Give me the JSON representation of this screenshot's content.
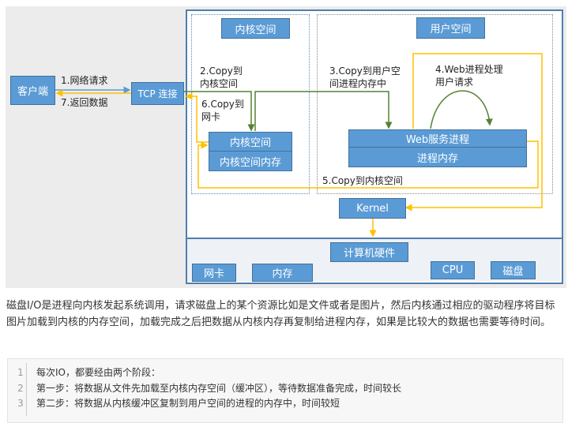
{
  "diagram": {
    "kernel_space_title": "内核空间",
    "user_space_title": "用户空间",
    "client": "客户端",
    "tcp": "TCP 连接",
    "step1": "1.网络请求",
    "step7": "7.返回数据",
    "step2": [
      "2.Copy到",
      "内核空间"
    ],
    "step6": [
      "6.Copy到",
      "网卡"
    ],
    "step3": [
      "3.Copy到用户空",
      "间进程内存中"
    ],
    "step4": [
      "4.Web进程处理",
      "用户请求"
    ],
    "step5": "5.Copy到内核空间",
    "kernel_box_top": "内核空间",
    "kernel_box_bottom": "内核空间内存",
    "web_top": "Web服务进程",
    "web_bottom": "进程内存",
    "kernel": "Kernel",
    "hardware": "计算机硬件",
    "nic": "网卡",
    "memory": "内存",
    "cpu": "CPU",
    "disk": "磁盘",
    "colors": {
      "box": "#5b9bd5",
      "green": "#548235",
      "yellow": "#ffc000",
      "blue_arrow": "#5b9bd5"
    }
  },
  "paragraph": "磁盘I/O是进程向内核发起系统调用，请求磁盘上的某个资源比如是文件或者是图片，然后内核通过相应的驱动程序将目标图片加载到内核的内存空间，加载完成之后把数据从内核内存再复制给进程内存，如果是比较大的数据也需要等待时间。",
  "code": {
    "lines": [
      {
        "n": "1",
        "text": "每次IO，都要经由两个阶段："
      },
      {
        "n": "2",
        "text": "第一步：将数据从文件先加载至内核内存空间（缓冲区），等待数据准备完成，时间较长"
      },
      {
        "n": "3",
        "text": "第二步：将数据从内核缓冲区复制到用户空间的进程的内存中，时间较短"
      }
    ]
  }
}
